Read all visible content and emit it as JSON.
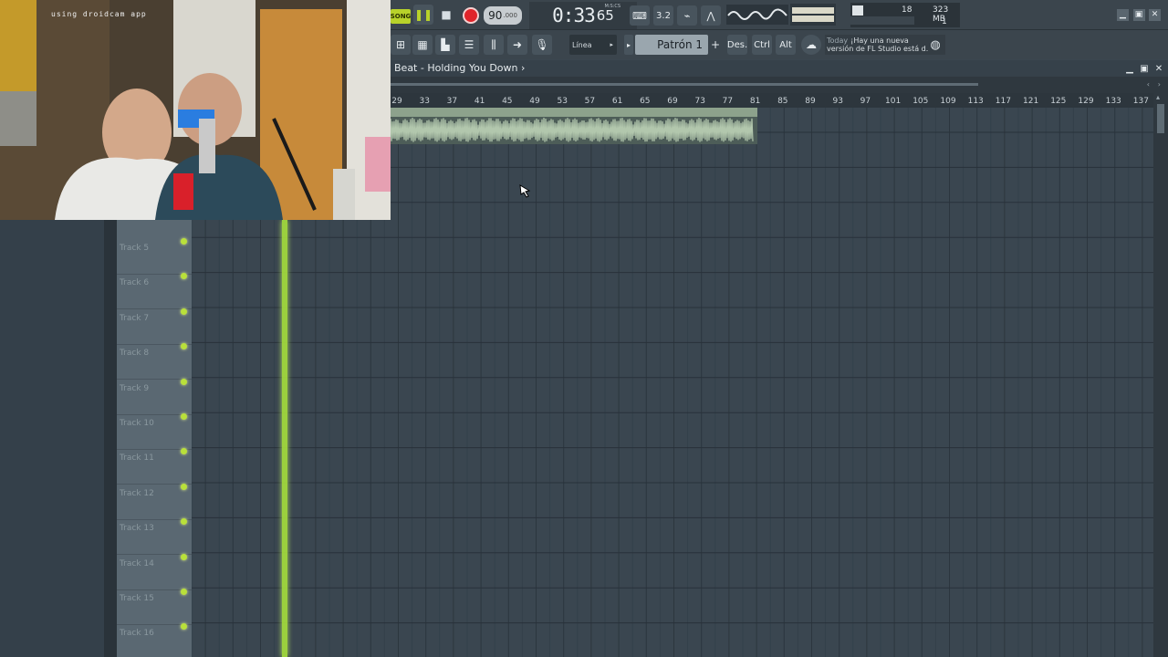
{
  "webcam": {
    "watermark": "using droidcam app"
  },
  "transport": {
    "mode_label": "SONG",
    "tempo": "90",
    "tempo_decimal": ".000",
    "time_main": "0:33",
    "time_centis": "65",
    "time_format_label": "M:S:CS",
    "cpu_value": "18",
    "memory": "323 MB",
    "polyphony": "1"
  },
  "toolbar": {
    "snap": "Línea",
    "pattern": "Patrón 1",
    "pattern_add": "+",
    "undo_label": "Des.",
    "ctrl_label": "Ctrl",
    "alt_label": "Alt",
    "news_day": "Today",
    "news_line1": "¡Hay una nueva",
    "news_line2": "versión de FL Studio está d."
  },
  "playlist": {
    "title": "Beat - Holding You Down",
    "ruler_numbers": [
      "29",
      "33",
      "37",
      "41",
      "45",
      "49",
      "53",
      "57",
      "61",
      "65",
      "69",
      "73",
      "77",
      "81",
      "85",
      "89",
      "93",
      "97",
      "101",
      "105",
      "109",
      "113",
      "117",
      "121",
      "125",
      "129",
      "133",
      "137"
    ],
    "tracks": [
      "Track 5",
      "Track 6",
      "Track 7",
      "Track 8",
      "Track 9",
      "Track 10",
      "Track 11",
      "Track 12",
      "Track 13",
      "Track 14",
      "Track 15",
      "Track 16"
    ]
  },
  "icons": {
    "pause": "pause-icon",
    "stop": "stop-icon",
    "record": "record-icon",
    "playlist": "playlist-icon",
    "mixer": "mixer-icon",
    "globe": "globe-icon"
  },
  "colors": {
    "accent_green": "#b8d22a",
    "record_red": "#e0242a",
    "playhead_green": "#a6e03d",
    "audio_clip": "#b2c7ad",
    "grid_bg": "#3a4650"
  }
}
